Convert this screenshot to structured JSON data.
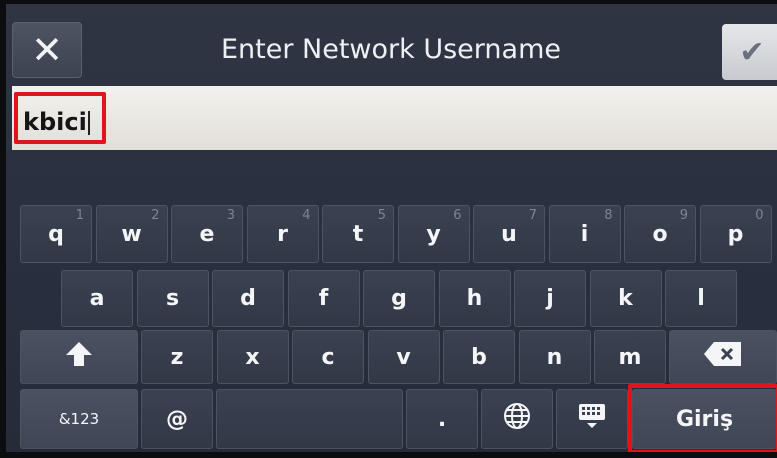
{
  "header": {
    "title": "Enter Network Username",
    "close_icon": "close-icon",
    "confirm_icon": "checkmark-icon"
  },
  "input": {
    "value": "kbici"
  },
  "keyboard": {
    "row1": [
      {
        "key": "q",
        "num": "1"
      },
      {
        "key": "w",
        "num": "2"
      },
      {
        "key": "e",
        "num": "3"
      },
      {
        "key": "r",
        "num": "4"
      },
      {
        "key": "t",
        "num": "5"
      },
      {
        "key": "y",
        "num": "6"
      },
      {
        "key": "u",
        "num": "7"
      },
      {
        "key": "i",
        "num": "8"
      },
      {
        "key": "o",
        "num": "9"
      },
      {
        "key": "p",
        "num": "0"
      }
    ],
    "row2": [
      "a",
      "s",
      "d",
      "f",
      "g",
      "h",
      "j",
      "k",
      "l"
    ],
    "row3": [
      "z",
      "x",
      "c",
      "v",
      "b",
      "n",
      "m"
    ],
    "symbols_label": "&123",
    "at_label": "@",
    "period_label": ".",
    "enter_label": "Giriş",
    "shift_icon": "shift-icon",
    "backspace_icon": "backspace-icon",
    "globe_icon": "globe-icon",
    "hide_keyboard_icon": "keyboard-hide-icon"
  },
  "colors": {
    "highlight": "#e0141a",
    "background": "#2d3340"
  }
}
